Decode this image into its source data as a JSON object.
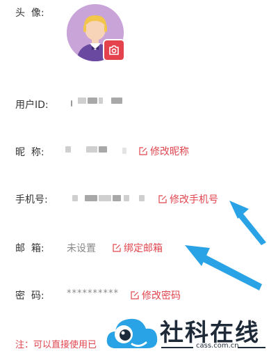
{
  "labels": {
    "avatar": "头  像:",
    "user_id": "用户ID:",
    "nickname": "昵  称:",
    "phone": "手机号:",
    "email": "邮  箱:",
    "password": "密  码:"
  },
  "values": {
    "email": "未设置",
    "password": "**********"
  },
  "actions": {
    "edit_nickname": "修改昵称",
    "edit_phone": "修改手机号",
    "bind_email": "绑定邮箱",
    "edit_password": "修改密码"
  },
  "note": "注：可以直接使用已",
  "watermark": {
    "brand": "社科在线",
    "domain": "cass.com.cn"
  },
  "colors": {
    "accent": "#e0454e",
    "arrow": "#2aa3e6",
    "avatar_bg": "#c9a4d8"
  },
  "icons": {
    "camera": "camera-icon",
    "edit": "edit-icon"
  }
}
